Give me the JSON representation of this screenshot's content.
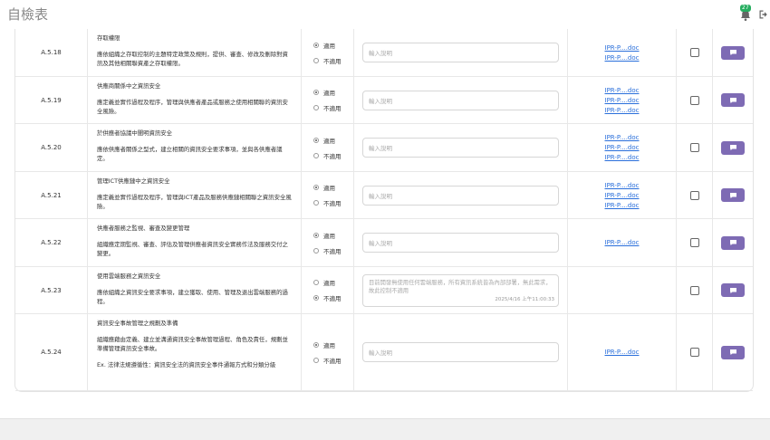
{
  "header": {
    "title": "自檢表",
    "notification_count": "27"
  },
  "labels": {
    "applicable": "適用",
    "not_applicable": "不適用"
  },
  "rows": [
    {
      "id": "A.5.18",
      "title": "存取權限",
      "desc": "應依組織之存取控制的主題特定政策及規則，提供、審查、修改及刪除對資訊及其他相關聯資產之存取權限。",
      "note": "",
      "selected": "applicable",
      "input_value": "",
      "placeholder": "輸入說明",
      "timestamp": "",
      "links": [
        "IPR-P....doc",
        "IPR-P....doc"
      ]
    },
    {
      "id": "A.5.19",
      "title": "供應商關係中之資訊安全",
      "desc": "應定義並實作過程及程序，管理與供應者產品或服務之使用相關聯的資訊安全風險。",
      "note": "",
      "selected": "applicable",
      "input_value": "",
      "placeholder": "輸入說明",
      "timestamp": "",
      "links": [
        "IPR-P....doc",
        "IPR-P....doc",
        "IPR-P....doc"
      ]
    },
    {
      "id": "A.5.20",
      "title": "於供應者協議中闡明資訊安全",
      "desc": "應依供應者關係之型式，建立相關的資訊安全要求事項，並與各供應者議定。",
      "note": "",
      "selected": "applicable",
      "input_value": "",
      "placeholder": "輸入說明",
      "timestamp": "",
      "links": [
        "IPR-P....doc",
        "IPR-P....doc",
        "IPR-P....doc"
      ]
    },
    {
      "id": "A.5.21",
      "title": "管理ICT供應鏈中之資訊安全",
      "desc": "應定義並實作過程及程序，管理與ICT產品及服務供應鏈相關聯之資訊安全風險。",
      "note": "",
      "selected": "applicable",
      "input_value": "",
      "placeholder": "輸入說明",
      "timestamp": "",
      "links": [
        "IPR-P....doc",
        "IPR-P....doc",
        "IPR-P....doc"
      ]
    },
    {
      "id": "A.5.22",
      "title": "供應者服務之監視、審查及變更管理",
      "desc": "組織應定期監視、審查、評估及管理供應者資訊安全實務作法及服務交付之變更。",
      "note": "",
      "selected": "applicable",
      "input_value": "",
      "placeholder": "輸入說明",
      "timestamp": "",
      "links": [
        "IPR-P....doc"
      ]
    },
    {
      "id": "A.5.23",
      "title": "使用雲端服務之資訊安全",
      "desc": "應依組織之資訊安全要求事項，建立獲取、使用、管理及退出雲端服務的過程。",
      "note": "",
      "selected": "not_applicable",
      "input_value": "目前開發無使用任何雲端服務，所有資訊系統皆為內部部署，無此需求，故此控制不適用",
      "placeholder": "",
      "timestamp": "2025/4/16 上午11:00:33",
      "links": []
    },
    {
      "id": "A.5.24",
      "title": "資訊安全事故管理之規劃及準備",
      "desc": "組織應藉由定義、建立並溝通資訊安全事故管理過程、角色及責任，規劃並準備管理資訊安全事故。",
      "note": "Ex. 法律法規遵循性：資訊安全法的資訊安全事件通報方式和分類分級",
      "selected": "applicable",
      "input_value": "",
      "placeholder": "輸入說明",
      "timestamp": "",
      "links": [
        "IPR-P....doc"
      ]
    }
  ]
}
